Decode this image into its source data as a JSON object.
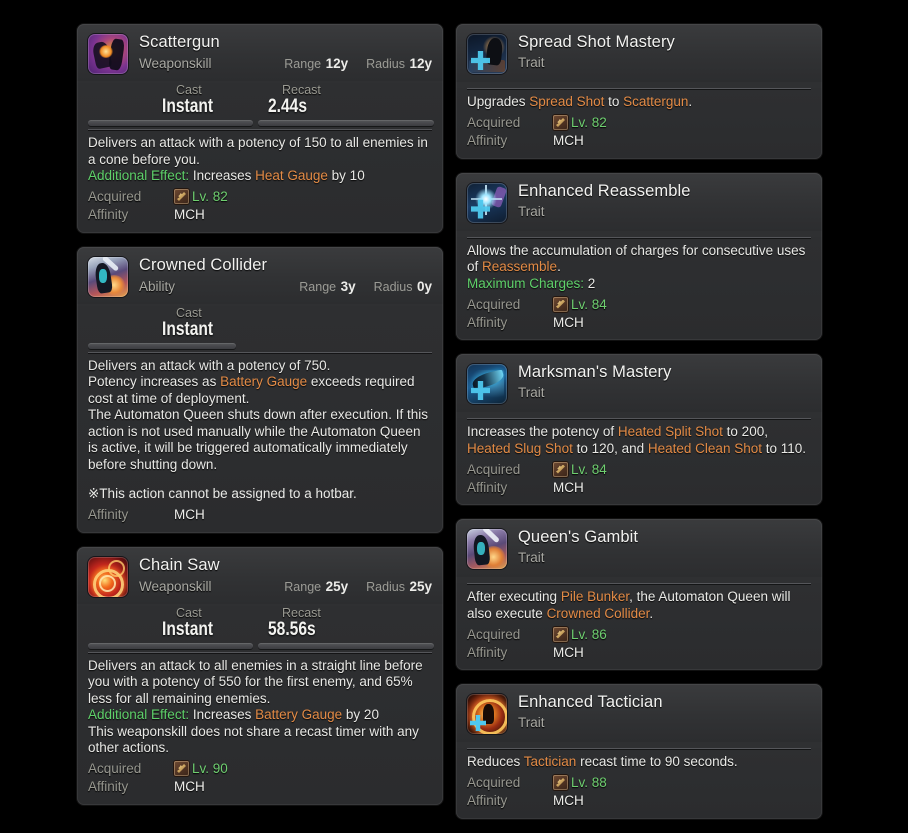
{
  "theme": {
    "page_bg": "#000000",
    "card_bg": "#2f3032",
    "accent_orange": "#e38b46",
    "accent_green": "#5fd16a",
    "level_green": "#6fcf70",
    "label_gray": "#9a9a92",
    "text_white": "#e9e9e6"
  },
  "labels": {
    "cast": "Cast",
    "recast": "Recast",
    "range": "Range",
    "radius": "Radius",
    "acquired": "Acquired",
    "affinity": "Affinity"
  },
  "left_column": [
    {
      "name": "Scattergun",
      "kind": "Weaponskill",
      "icon": "scattergun-icon",
      "range_label": "Range",
      "range": "12y",
      "radius_label": "Radius",
      "radius": "12y",
      "cast_label": "Cast",
      "cast": "Instant",
      "recast_label": "Recast",
      "recast": "2.44s",
      "description_parts": [
        {
          "t": "Delivers an attack with a potency of 150 to all enemies in a cone before you.\n",
          "c": "plain"
        },
        {
          "t": "Additional Effect:",
          "c": "green"
        },
        {
          "t": " Increases ",
          "c": "plain"
        },
        {
          "t": "Heat Gauge",
          "c": "orange"
        },
        {
          "t": " by 10",
          "c": "plain"
        }
      ],
      "acquired_label": "Acquired",
      "acquired_level": "Lv. 82",
      "affinity_label": "Affinity",
      "affinity": "MCH"
    },
    {
      "name": "Crowned Collider",
      "kind": "Ability",
      "icon": "crowned-collider-icon",
      "range_label": "Range",
      "range": "3y",
      "radius_label": "Radius",
      "radius": "0y",
      "cast_label": "Cast",
      "cast": "Instant",
      "recast_label": "",
      "recast": "",
      "description_parts": [
        {
          "t": "Delivers an attack with a potency of 750.\nPotency increases as ",
          "c": "plain"
        },
        {
          "t": "Battery Gauge",
          "c": "orange"
        },
        {
          "t": " exceeds required cost at time of deployment.\nThe Automaton Queen shuts down after execution. If this action is not used manually while the Automaton Queen is active, it will be triggered automatically immediately before shutting down.",
          "c": "plain"
        }
      ],
      "note": "※This action cannot be assigned to a hotbar.",
      "acquired_label": "",
      "acquired_level": "",
      "affinity_label": "Affinity",
      "affinity": "MCH"
    },
    {
      "name": "Chain Saw",
      "kind": "Weaponskill",
      "icon": "chain-saw-icon",
      "range_label": "Range",
      "range": "25y",
      "radius_label": "Radius",
      "radius": "25y",
      "cast_label": "Cast",
      "cast": "Instant",
      "recast_label": "Recast",
      "recast": "58.56s",
      "description_parts": [
        {
          "t": "Delivers an attack to all enemies in a straight line before you with a potency of 550 for the first enemy, and 65% less for all remaining enemies.\n",
          "c": "plain"
        },
        {
          "t": "Additional Effect:",
          "c": "green"
        },
        {
          "t": " Increases ",
          "c": "plain"
        },
        {
          "t": "Battery Gauge",
          "c": "orange"
        },
        {
          "t": " by 20\nThis weaponskill does not share a recast timer with any other actions.",
          "c": "plain"
        }
      ],
      "acquired_label": "Acquired",
      "acquired_level": "Lv. 90",
      "affinity_label": "Affinity",
      "affinity": "MCH"
    }
  ],
  "right_column": [
    {
      "name": "Spread Shot Mastery",
      "kind": "Trait",
      "icon": "spread-shot-mastery-icon",
      "description_parts": [
        {
          "t": "Upgrades ",
          "c": "plain"
        },
        {
          "t": "Spread Shot",
          "c": "orange"
        },
        {
          "t": " to ",
          "c": "plain"
        },
        {
          "t": "Scattergun",
          "c": "orange"
        },
        {
          "t": ".",
          "c": "plain"
        }
      ],
      "acquired_label": "Acquired",
      "acquired_level": "Lv. 82",
      "affinity_label": "Affinity",
      "affinity": "MCH"
    },
    {
      "name": "Enhanced Reassemble",
      "kind": "Trait",
      "icon": "enhanced-reassemble-icon",
      "description_parts": [
        {
          "t": "Allows the accumulation of charges for consecutive uses of ",
          "c": "plain"
        },
        {
          "t": "Reassemble",
          "c": "orange"
        },
        {
          "t": ".\n",
          "c": "plain"
        },
        {
          "t": "Maximum Charges:",
          "c": "green"
        },
        {
          "t": " 2",
          "c": "plain"
        }
      ],
      "acquired_label": "Acquired",
      "acquired_level": "Lv. 84",
      "affinity_label": "Affinity",
      "affinity": "MCH"
    },
    {
      "name": "Marksman's Mastery",
      "kind": "Trait",
      "icon": "marksmans-mastery-icon",
      "description_parts": [
        {
          "t": "Increases the potency of ",
          "c": "plain"
        },
        {
          "t": "Heated Split Shot",
          "c": "orange"
        },
        {
          "t": " to 200, ",
          "c": "plain"
        },
        {
          "t": "Heated Slug Shot",
          "c": "orange"
        },
        {
          "t": " to 120, and ",
          "c": "plain"
        },
        {
          "t": "Heated Clean Shot",
          "c": "orange"
        },
        {
          "t": " to 110.",
          "c": "plain"
        }
      ],
      "acquired_label": "Acquired",
      "acquired_level": "Lv. 84",
      "affinity_label": "Affinity",
      "affinity": "MCH"
    },
    {
      "name": "Queen's Gambit",
      "kind": "Trait",
      "icon": "queens-gambit-icon",
      "description_parts": [
        {
          "t": "After executing ",
          "c": "plain"
        },
        {
          "t": "Pile Bunker",
          "c": "orange"
        },
        {
          "t": ", the Automaton Queen will also execute ",
          "c": "plain"
        },
        {
          "t": "Crowned Collider",
          "c": "orange"
        },
        {
          "t": ".",
          "c": "plain"
        }
      ],
      "acquired_label": "Acquired",
      "acquired_level": "Lv. 86",
      "affinity_label": "Affinity",
      "affinity": "MCH"
    },
    {
      "name": "Enhanced Tactician",
      "kind": "Trait",
      "icon": "enhanced-tactician-icon",
      "description_parts": [
        {
          "t": "Reduces ",
          "c": "plain"
        },
        {
          "t": "Tactician",
          "c": "orange"
        },
        {
          "t": " recast time to 90 seconds.",
          "c": "plain"
        }
      ],
      "acquired_label": "Acquired",
      "acquired_level": "Lv. 88",
      "affinity_label": "Affinity",
      "affinity": "MCH"
    }
  ]
}
